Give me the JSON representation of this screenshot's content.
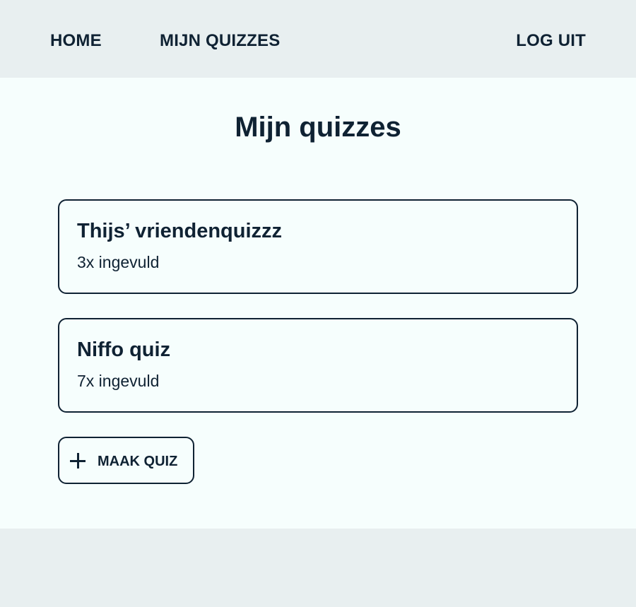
{
  "nav": {
    "home": "HOME",
    "my_quizzes": "MIJN QUIZZES",
    "logout": "LOG UIT"
  },
  "main": {
    "title": "Mijn quizzes",
    "quizzes": [
      {
        "title": "Thijs’ vriendenquizzz",
        "count": "3x ingevuld"
      },
      {
        "title": "Niffo quiz",
        "count": "7x ingevuld"
      }
    ],
    "create_button": {
      "label": "MAAK QUIZ",
      "icon": "plus-icon"
    }
  },
  "colors": {
    "text": "#0f2233",
    "background": "#e8eff0",
    "content_background": "#f6fefd"
  }
}
